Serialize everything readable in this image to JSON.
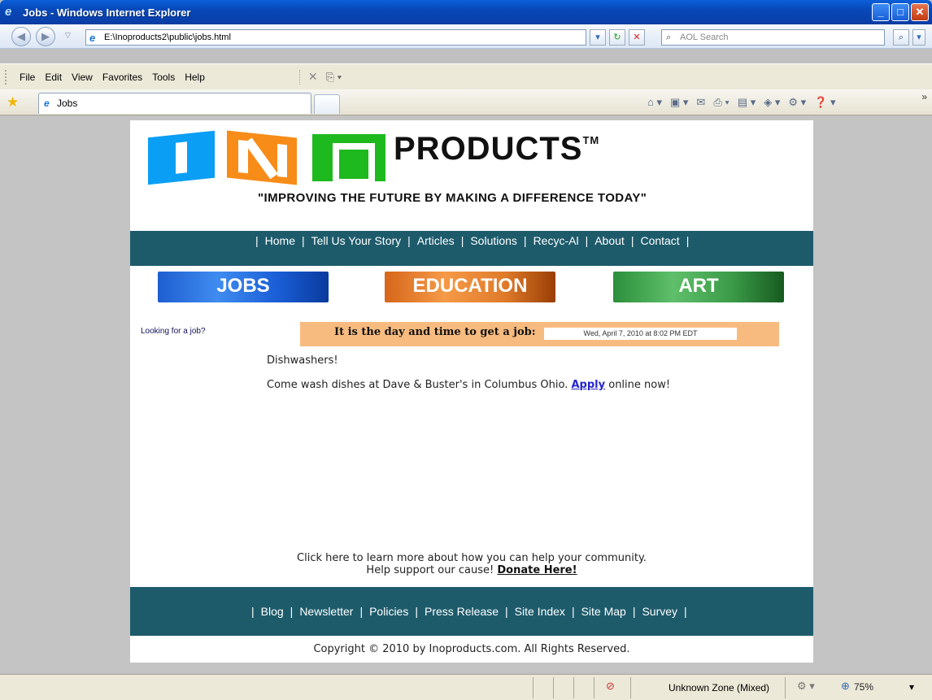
{
  "window": {
    "title": "Jobs - Windows Internet Explorer"
  },
  "address": {
    "url": "E:\\Inoproducts2\\public\\jobs.html",
    "search_placeholder": "AOL Search"
  },
  "menu": [
    "File",
    "Edit",
    "View",
    "Favorites",
    "Tools",
    "Help"
  ],
  "tab": {
    "label": "Jobs"
  },
  "header": {
    "logo_letters": [
      "I",
      "N",
      "O"
    ],
    "logo_word": "PRODUCTS",
    "trademark": "TM",
    "tagline": "\"IMPROVING THE FUTURE BY MAKING A DIFFERENCE TODAY\""
  },
  "nav": [
    "Home",
    "Tell Us Your Story",
    "Articles",
    "Solutions",
    "Recyc-Al",
    "About",
    "Contact"
  ],
  "categories": {
    "jobs": "JOBS",
    "education": "EDUCATION",
    "art": "ART"
  },
  "sidebar": {
    "looking": "Looking for a job?"
  },
  "datetime": {
    "label": "It is the day and time to get a job:",
    "value": "Wed, April 7, 2010 at 8:02 PM EDT"
  },
  "job": {
    "title": "Dishwashers!",
    "desc_before": "Come wash dishes at Dave & Buster's in Columbus Ohio.",
    "apply_link": "Apply",
    "desc_after": "online now!"
  },
  "help": {
    "line1": "Click here to learn more about how you can help your community.",
    "line2_before": "Help support our cause!",
    "donate_link": "Donate Here!"
  },
  "footer_nav": [
    "Blog",
    "Newsletter",
    "Policies",
    "Press Release",
    "Site Index",
    "Site Map",
    "Survey"
  ],
  "copyright": "Copyright © 2010 by Inoproducts.com. All Rights Reserved.",
  "status": {
    "zone": "Unknown Zone (Mixed)",
    "zoom": "75%"
  },
  "colors": {
    "nav_bg": "#1d5b6b",
    "date_bar": "#f8bb7f",
    "link": "#2525cc"
  }
}
